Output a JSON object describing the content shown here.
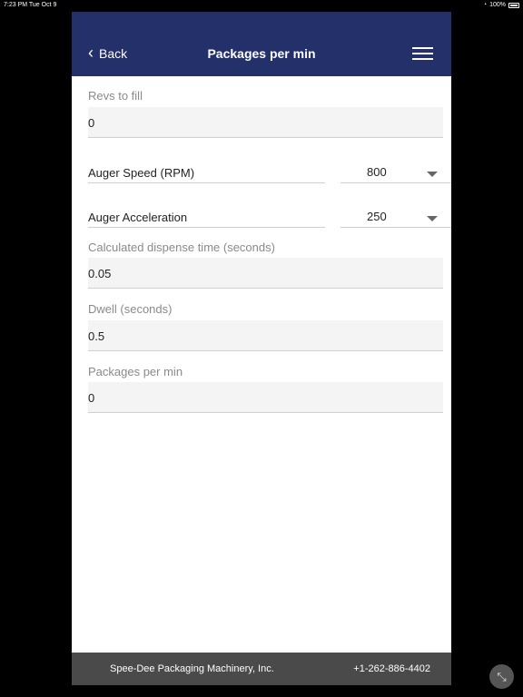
{
  "status_bar": {
    "time_date": "7:23 PM   Tue Oct 9",
    "battery": "100%"
  },
  "nav": {
    "back_label": "Back",
    "title": "Packages per min"
  },
  "form": {
    "revs_to_fill": {
      "label": "Revs to fill",
      "value": "0"
    },
    "auger_speed": {
      "label": "Auger Speed (RPM)",
      "value": "800"
    },
    "auger_acceleration": {
      "label": "Auger Acceleration",
      "value": "250"
    },
    "dispense_time": {
      "label": "Calculated dispense time (seconds)",
      "value": "0.05"
    },
    "dwell": {
      "label": "Dwell (seconds)",
      "value": "0.5"
    },
    "packages_per_min": {
      "label": "Packages per min",
      "value": "0"
    }
  },
  "footer": {
    "company": "Spee-Dee Packaging Machinery, Inc.",
    "phone": "+1-262-886-4402"
  },
  "colors": {
    "nav_bg": "#23306a",
    "footer_bg": "#4a4a4a"
  }
}
